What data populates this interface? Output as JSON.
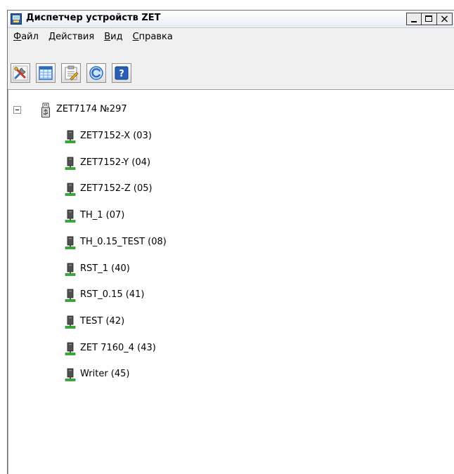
{
  "window": {
    "title": "Диспетчер устройств ZET",
    "close_glyph": "×"
  },
  "menu": [
    {
      "accel": "Ф",
      "rest": "айл"
    },
    {
      "accel": "Д",
      "rest": "ействия"
    },
    {
      "accel": "В",
      "rest": "ид"
    },
    {
      "accel": "С",
      "rest": "правка"
    }
  ],
  "toolbar": [
    {
      "icon": "tools-icon"
    },
    {
      "icon": "table-icon"
    },
    {
      "icon": "properties-icon"
    },
    {
      "icon": "refresh-icon"
    },
    {
      "icon": "help-icon",
      "glyph": "?"
    }
  ],
  "tree": {
    "root": {
      "label": "ZET7174 №297",
      "expanded": true
    },
    "children": [
      {
        "label": "ZET7152-X (03)"
      },
      {
        "label": "ZET7152-Y (04)"
      },
      {
        "label": "ZET7152-Z (05)"
      },
      {
        "label": "TH_1 (07)"
      },
      {
        "label": "TH_0.15_TEST (08)"
      },
      {
        "label": "RST_1 (40)"
      },
      {
        "label": "RST_0.15 (41)"
      },
      {
        "label": "TEST (42)"
      },
      {
        "label": "ZET 7160_4 (43)"
      },
      {
        "label": "Writer (45)"
      }
    ]
  },
  "colors": {
    "title_bg": "#e9eef6",
    "panel_bg": "#f0f0f0",
    "device_green": "#2bb02b",
    "device_dark": "#505050"
  }
}
